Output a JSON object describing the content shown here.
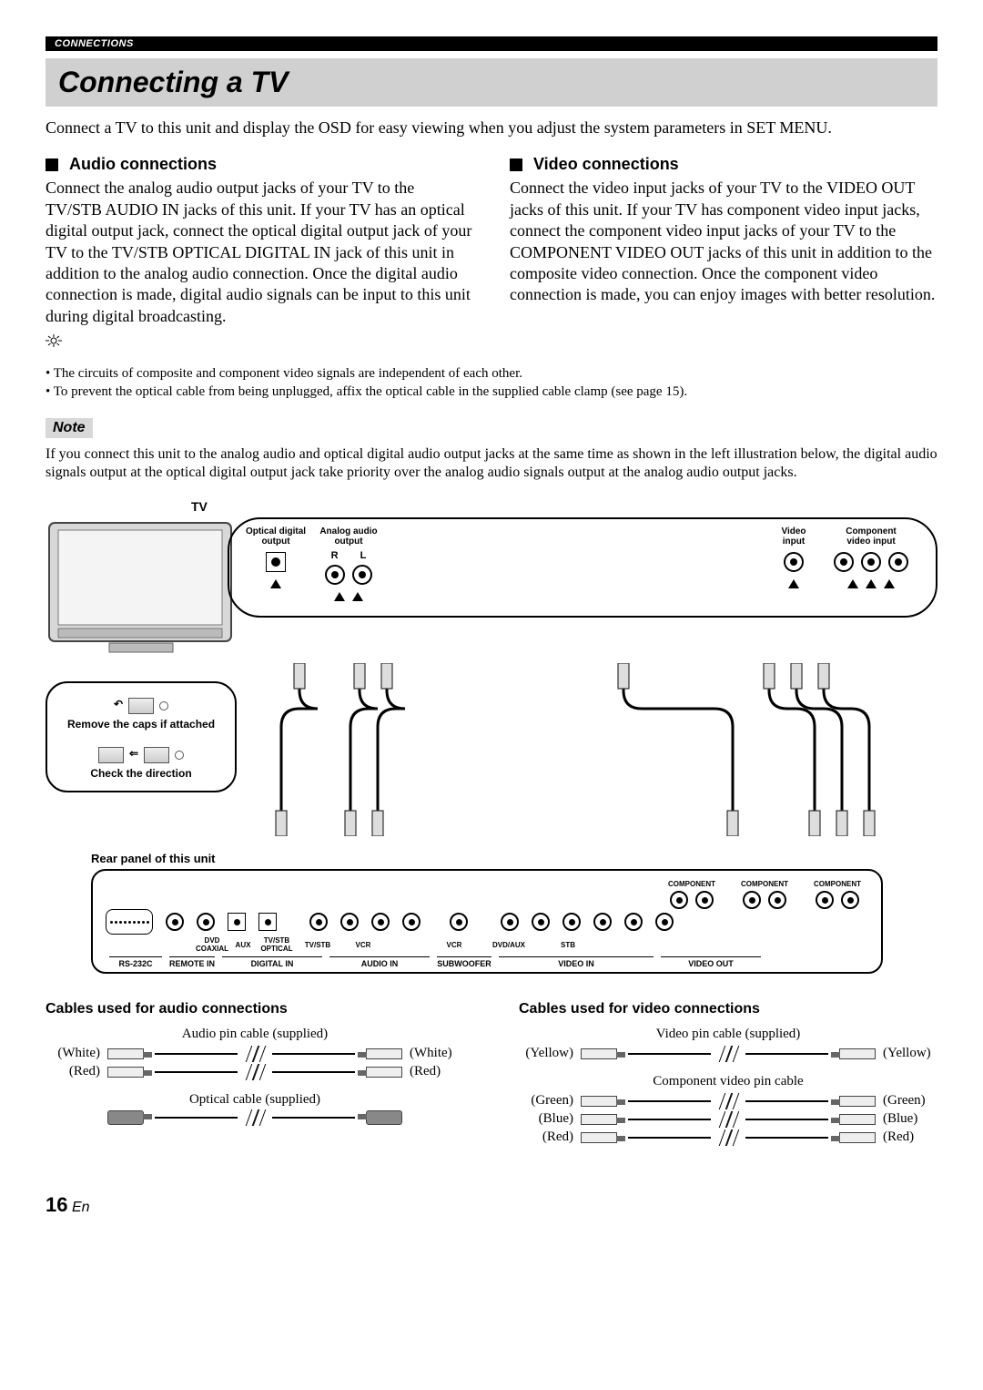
{
  "header": {
    "section": "CONNECTIONS"
  },
  "title": "Connecting a TV",
  "intro": "Connect a TV to this unit and display the OSD for easy viewing when you adjust the system parameters in SET MENU.",
  "audio": {
    "heading": "Audio connections",
    "body": "Connect the analog audio output jacks of your TV to the TV/STB AUDIO IN jacks of this unit. If your TV has an optical digital output jack, connect the optical digital output jack of your TV to the TV/STB OPTICAL DIGITAL IN jack of this unit in addition to the analog audio connection. Once the digital audio connection is made, digital audio signals can be input to this unit during digital broadcasting."
  },
  "video": {
    "heading": "Video connections",
    "body": "Connect the video input jacks of your TV to the VIDEO OUT jacks of this unit. If your TV has component video input jacks, connect the component video input jacks of your TV to the COMPONENT VIDEO OUT jacks of this unit in addition to the composite video connection. Once the component video connection is made, you can enjoy images with better resolution."
  },
  "tips": [
    "The circuits of composite and component video signals are independent of each other.",
    "To prevent the optical cable from being unplugged, affix the optical cable in the supplied cable clamp (see page 15)."
  ],
  "note": {
    "label": "Note",
    "body": "If you connect this unit to the analog audio and optical digital audio output jacks at the same time as shown in the left illustration below, the digital audio signals output at the optical digital output jack take priority over the analog audio signals output at the analog audio output jacks."
  },
  "diagram": {
    "tv_label": "TV",
    "tv_ports": {
      "optical": "Optical digital\noutput",
      "analog": "Analog audio\noutput",
      "rl": {
        "r": "R",
        "l": "L"
      },
      "video": "Video\ninput",
      "component": "Component\nvideo input"
    },
    "callout": {
      "line1": "Remove the caps if attached",
      "line2": "Check the direction"
    },
    "rear_label": "Rear panel of this unit",
    "rear": {
      "component": "COMPONENT",
      "mini": {
        "dvd": "DVD",
        "coaxial": "COAXIAL",
        "aux": "AUX",
        "tvstb": "TV/STB",
        "optical": "OPTICAL",
        "tvstb2": "TV/STB",
        "vcr": "VCR",
        "vcr2": "VCR",
        "dvdaux": "DVD/AUX",
        "stb": "STB"
      },
      "groups": {
        "rs232c": "RS-232C",
        "remotein": "REMOTE IN",
        "digitalin": "DIGITAL IN",
        "audioin": "AUDIO IN",
        "subwoofer": "SUBWOOFER",
        "videoin": "VIDEO IN",
        "videoout": "VIDEO OUT"
      }
    }
  },
  "cables": {
    "audio": {
      "heading": "Cables used for audio connections",
      "pin": "Audio pin cable (supplied)",
      "optical": "Optical cable (supplied)",
      "colors": {
        "white": "(White)",
        "red": "(Red)"
      }
    },
    "video": {
      "heading": "Cables used for video connections",
      "pin": "Video pin cable (supplied)",
      "component": "Component video pin cable",
      "colors": {
        "yellow": "(Yellow)",
        "green": "(Green)",
        "blue": "(Blue)",
        "red": "(Red)"
      }
    }
  },
  "footer": {
    "page": "16",
    "lang": "En"
  }
}
